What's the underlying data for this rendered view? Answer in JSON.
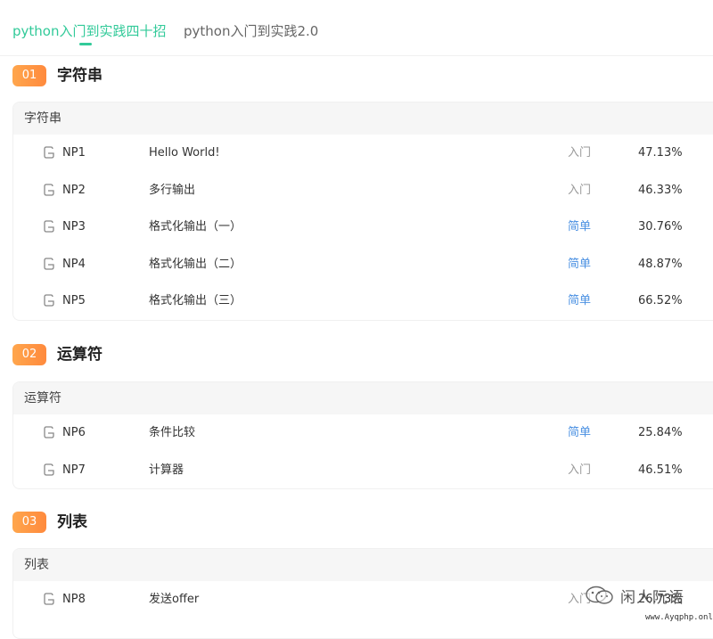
{
  "tabs": [
    {
      "label": "python入门到实践四十招",
      "active": true
    },
    {
      "label": "python入门到实践2.0",
      "active": false
    }
  ],
  "colors": {
    "accent": "#32ca99",
    "badge": "#ff963f",
    "easy": "#4a90e2",
    "intro": "#999999"
  },
  "sections": [
    {
      "badge": "01",
      "title": "字符串",
      "card_header": "字符串",
      "rows": [
        {
          "id": "NP1",
          "name": "Hello World!",
          "difficulty": "入门",
          "rate": "47.13%"
        },
        {
          "id": "NP2",
          "name": "多行输出",
          "difficulty": "入门",
          "rate": "46.33%"
        },
        {
          "id": "NP3",
          "name": "格式化输出（一）",
          "difficulty": "简单",
          "rate": "30.76%"
        },
        {
          "id": "NP4",
          "name": "格式化输出（二）",
          "difficulty": "简单",
          "rate": "48.87%"
        },
        {
          "id": "NP5",
          "name": "格式化输出（三）",
          "difficulty": "简单",
          "rate": "66.52%"
        }
      ]
    },
    {
      "badge": "02",
      "title": "运算符",
      "card_header": "运算符",
      "rows": [
        {
          "id": "NP6",
          "name": "条件比较",
          "difficulty": "简单",
          "rate": "25.84%"
        },
        {
          "id": "NP7",
          "name": "计算器",
          "difficulty": "入门",
          "rate": "46.51%"
        }
      ]
    },
    {
      "badge": "03",
      "title": "列表",
      "card_header": "列表",
      "rows": [
        {
          "id": "NP8",
          "name": "发送offer",
          "difficulty": "入门",
          "rate": "26.73%"
        }
      ]
    }
  ],
  "watermark": {
    "text": "闲人阮语",
    "url": "www.Ayqphp.online",
    "icon": "wechat-icon"
  }
}
